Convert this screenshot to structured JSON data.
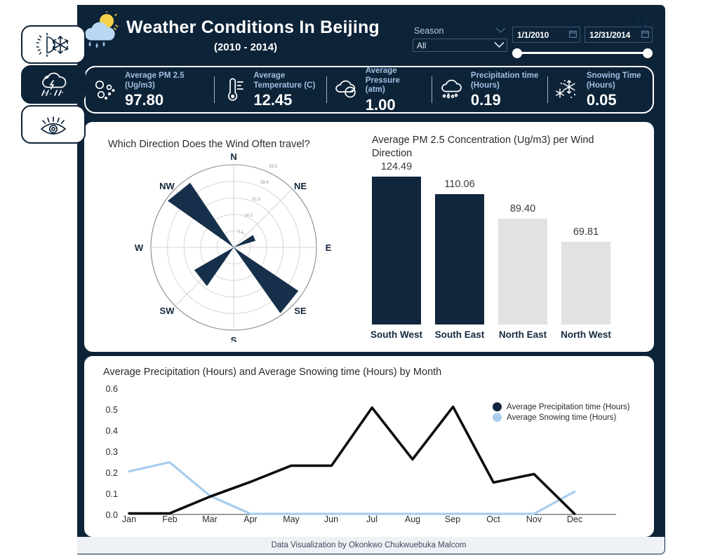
{
  "colors": {
    "navy": "#0d2338",
    "light_blue": "#a8cdee",
    "bar_dark": "#10263d",
    "bar_light": "#e2e2e2",
    "card_white": "#ffffff"
  },
  "sidebar": {
    "items": [
      {
        "name": "temperature-tab",
        "icon": "sun-snowflake-icon",
        "active": false
      },
      {
        "name": "precipitation-tab",
        "icon": "storm-cloud-rain-icon",
        "active": true
      },
      {
        "name": "visibility-tab",
        "icon": "eye-icon",
        "active": false
      }
    ]
  },
  "header": {
    "logo_icon": "cloud-sun-rain-icon",
    "title": "Weather Conditions In Beijing",
    "subtitle": "(2010 - 2014)",
    "season_filter": {
      "label": "Season",
      "value": "All",
      "chevron_icon": "chevron-down-icon"
    },
    "date_range": {
      "start": "1/1/2010",
      "end": "12/31/2014",
      "calendar_icon": "calendar-icon"
    },
    "refresh_icon": "refresh-icon"
  },
  "kpis": [
    {
      "icon": "particles-icon",
      "label": "Average PM 2.5\n(Ug/m3)",
      "label_line1": "Average PM 2.5",
      "label_line2": "(Ug/m3)",
      "value": "97.80"
    },
    {
      "icon": "thermometer-icon",
      "label": "Average Temperature (C)",
      "label_line1": "Average",
      "label_line2": "Temperature (C)",
      "value": "12.45"
    },
    {
      "icon": "pressure-icon",
      "label": "Average Pressure (atm)",
      "label_line1": "Average Pressure",
      "label_line2": "(atm)",
      "value": "1.00"
    },
    {
      "icon": "rain-cloud-icon",
      "label": "Precipitation time (Hours)",
      "label_line1": "Precipitation time",
      "label_line2": "(Hours)",
      "value": "0.19"
    },
    {
      "icon": "snowflake-icon",
      "label": "Snowing Time (Hours)",
      "label_line1": "Snowing Time",
      "label_line2": "(Hours)",
      "value": "0.05"
    }
  ],
  "chart_data": [
    {
      "type": "bar",
      "chart_name": "wind-rose",
      "title": "Which Direction Does the Wind Often travel?",
      "subtype": "polar-wind-rose",
      "compass_labels": [
        "N",
        "NE",
        "E",
        "SE",
        "S",
        "SW",
        "W",
        "NW"
      ],
      "radial_ticks": [
        "7.1",
        "14.2",
        "21.3",
        "28.4",
        "35.5"
      ],
      "rmax": 35.5,
      "categories": [
        "NE",
        "SE",
        "SW",
        "NW"
      ],
      "values": [
        10.0,
        34.0,
        20.0,
        34.0
      ],
      "petal_color": "#16304b"
    },
    {
      "type": "bar",
      "chart_name": "pm25-by-wind-direction",
      "title": "Average PM 2.5 Concentration (Ug/m3) per Wind Direction",
      "categories": [
        "South West",
        "South East",
        "North East",
        "North West"
      ],
      "values": [
        124.49,
        110.06,
        89.4,
        69.81
      ],
      "value_labels": [
        "124.49",
        "110.06",
        "89.40",
        "69.81"
      ],
      "bar_colors": [
        "#10263d",
        "#10263d",
        "#e2e2e2",
        "#e2e2e2"
      ],
      "ylim": [
        0,
        135
      ],
      "xlabel": "",
      "ylabel": ""
    },
    {
      "type": "line",
      "chart_name": "precipitation-and-snowing-by-month",
      "title": "Average Precipitation (Hours) and Average Snowing time (Hours) by Month",
      "categories": [
        "Jan",
        "Feb",
        "Mar",
        "Apr",
        "May",
        "Jun",
        "Jul",
        "Aug",
        "Sep",
        "Oct",
        "Nov",
        "Dec"
      ],
      "ytick_labels": [
        "0.6",
        "0.5",
        "0.4",
        "0.3",
        "0.2",
        "0.1",
        "0.0"
      ],
      "ylim": [
        0,
        0.6
      ],
      "grid": false,
      "legend_position": "top-right",
      "series": [
        {
          "name": "Average Precipitation time (Hours)",
          "color": "#0d0d0d",
          "values": [
            0.005,
            0.005,
            0.085,
            0.155,
            0.232,
            0.232,
            0.508,
            0.262,
            0.512,
            0.152,
            0.192,
            0.003
          ]
        },
        {
          "name": "Average Snowing time (Hours)",
          "color": "#a8cdee",
          "values": [
            0.205,
            0.248,
            0.088,
            0.003,
            0.003,
            0.003,
            0.003,
            0.003,
            0.003,
            0.003,
            0.003,
            0.108
          ]
        }
      ]
    }
  ],
  "footer": {
    "text": "Data Visualization by Okonkwo Chukwuebuka Malcom"
  }
}
